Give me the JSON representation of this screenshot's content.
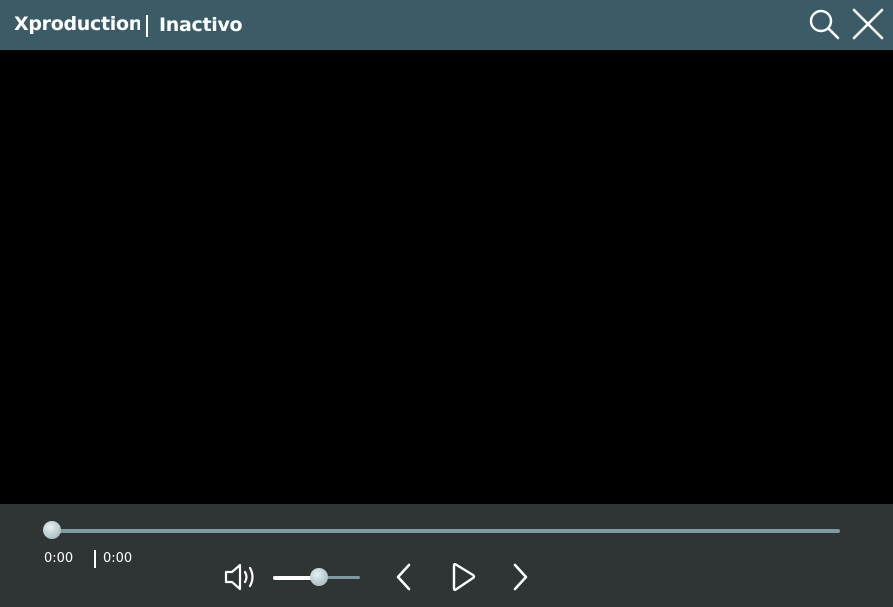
{
  "titlebar": {
    "app_name": "Xproduction",
    "status": "Inactivo",
    "background_color": "#3b5c66",
    "icons": {
      "search": "search-icon",
      "close": "close-icon"
    }
  },
  "player": {
    "video_background": "#000000",
    "progress": 0.0,
    "time_current": "0:00",
    "time_total": "0:00",
    "volume": 0.53,
    "icons": {
      "volume": "volume-icon",
      "previous": "chevron-left-icon",
      "play": "play-icon",
      "next": "chevron-right-icon"
    }
  }
}
